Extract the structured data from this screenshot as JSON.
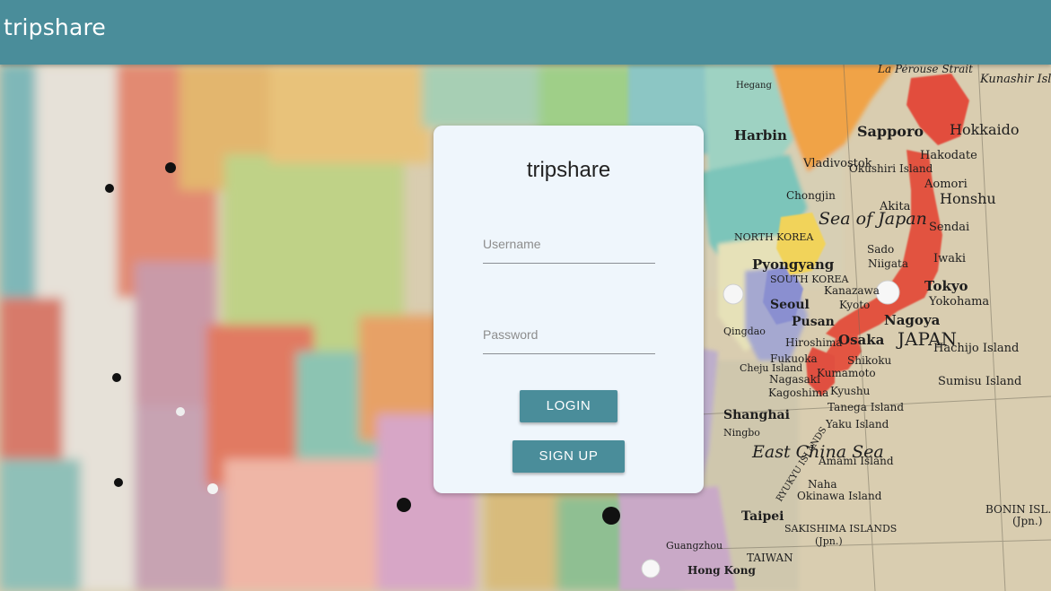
{
  "header": {
    "title": "tripshare"
  },
  "login": {
    "title": "tripshare",
    "username_placeholder": "Username",
    "password_placeholder": "Password",
    "login_label": "LOGIN",
    "signup_label": "SIGN UP"
  },
  "map_labels": {
    "la_perouse": "La Pérouse Strait",
    "kunashir": "Kunashir Island",
    "hegang": "Hegang",
    "harbin": "Harbin",
    "vladivostok": "Vladivostok",
    "sapporo": "Sapporo",
    "hokkaido": "Hokkaido",
    "hakodate": "Hakodate",
    "okushiri": "Okushiri Island",
    "aomori": "Aomori",
    "honshu": "Honshu",
    "chongjin": "Chongjin",
    "sea_of_japan": "Sea of Japan",
    "akita": "Akita",
    "sendai": "Sendai",
    "north_korea": "NORTH KOREA",
    "pyongyang": "Pyongyang",
    "sado": "Sado",
    "niigata": "Niigata",
    "iwaki": "Iwaki",
    "south_korea": "SOUTH KOREA",
    "seoul": "Seoul",
    "kanazawa": "Kanazawa",
    "tokyo": "Tokyo",
    "kyoto": "Kyoto",
    "yokohama": "Yokohama",
    "pusan": "Pusan",
    "nagoya": "Nagoya",
    "osaka": "Osaka",
    "japan": "JAPAN",
    "hachijo": "Hachijo Island",
    "hiroshima": "Hiroshima",
    "fukuoka": "Fukuoka",
    "shikoku": "Shikoku",
    "cheju": "Cheju Island",
    "nagasaki": "Nagasaki",
    "kumamoto": "Kumamoto",
    "kagoshima": "Kagoshima",
    "kyushu": "Kyushu",
    "sumisu": "Sumisu Island",
    "tanega": "Tanega Island",
    "yaku": "Yaku Island",
    "shanghai": "Shanghai",
    "east_china_sea": "East China Sea",
    "amami": "Amami Island",
    "ryukyu": "RYUKYU ISLANDS",
    "naha": "Naha",
    "okinawa": "Okinawa Island",
    "bonin": "BONIN ISL.",
    "bonin_jpn": "(Jpn.)",
    "taipei": "Taipei",
    "sakishima": "SAKISHIMA ISLANDS",
    "sakishima_jpn": "(Jpn.)",
    "taiwan": "TAIWAN",
    "guangzhou": "Guangzhou",
    "hong_kong": "Hong Kong",
    "qingdao": "Qingdao",
    "ningbo": "Ningbo"
  },
  "colors": {
    "accent": "#4a8d9a",
    "card_bg": "#eff6fc"
  }
}
